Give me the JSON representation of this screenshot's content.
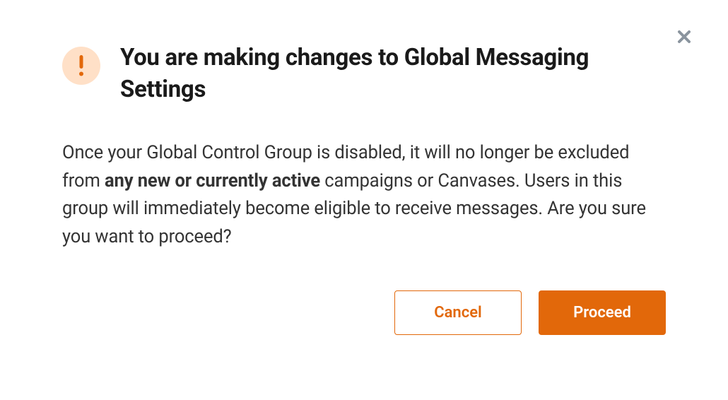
{
  "modal": {
    "title": "You are making changes to Global Messaging Settings",
    "body_prefix": "Once your Global Control Group is disabled, it will no longer be excluded from ",
    "body_bold": "any new or currently active",
    "body_suffix": " campaigns or Canvases. Users in this group will immediately become eligible to receive messages. Are you sure you want to proceed?",
    "buttons": {
      "cancel": "Cancel",
      "proceed": "Proceed"
    }
  },
  "colors": {
    "accent": "#e2680a",
    "icon_bg": "#ffe0c7"
  }
}
